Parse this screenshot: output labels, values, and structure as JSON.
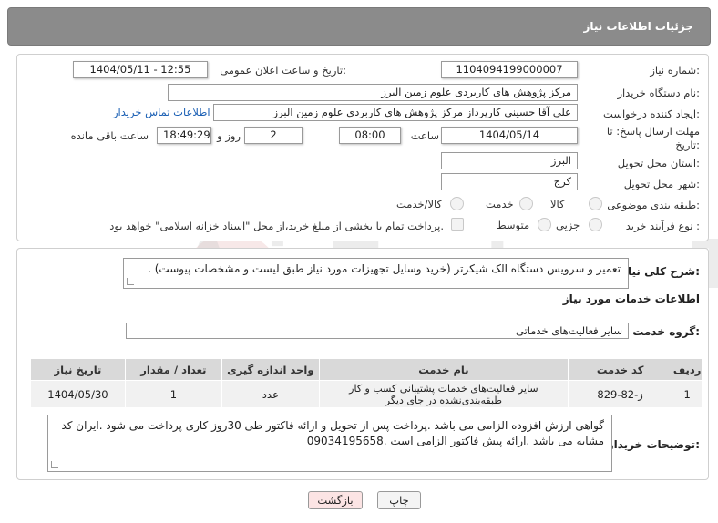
{
  "header": {
    "title": "جزئیات اطلاعات نیاز"
  },
  "form": {
    "need_number_label": "شماره نیاز:",
    "need_number": "1104094199000007",
    "announce_label": "تاریخ و ساعت اعلان عمومی:",
    "announce_value": "1404/05/11 - 12:55",
    "buyer_org_label": "نام دستگاه خریدار:",
    "buyer_org": "مرکز پژوهش های کاربردی علوم زمین البرز",
    "requester_label": "ایجاد کننده درخواست:",
    "requester": "علی آقا حسینی کارپرداز مرکز پژوهش های کاربردی علوم زمین البرز",
    "contact_link": "اطلاعات تماس خریدار",
    "deadline_label_line1": "مهلت ارسال پاسخ: تا",
    "deadline_label_line2": "تاریخ:",
    "deadline_date": "1404/05/14",
    "time_label": "ساعت",
    "deadline_time": "08:00",
    "days_value": "2",
    "days_label": "روز و",
    "remaining_time": "18:49:29",
    "remaining_label": "ساعت باقی مانده",
    "province_label": "استان محل تحویل:",
    "province": "البرز",
    "city_label": "شهر محل تحویل:",
    "city": "کرج",
    "category_label": "طبقه بندی موضوعی:",
    "category_options": [
      "کالا",
      "خدمت",
      "کالا/خدمت"
    ],
    "process_label": "نوع فرآیند خرید :",
    "process_options": [
      "جزیی",
      "متوسط"
    ],
    "payment_note": "پرداخت تمام یا بخشی از مبلغ خرید،از محل \"اسناد خزانه اسلامی\" خواهد بود."
  },
  "details": {
    "summary_label": "شرح کلی نیاز:",
    "summary": "تعمیر و سرویس دستگاه الک شیکرتر (خرید وسایل تجهیزات مورد نیاز طبق لیست و مشخصات پیوست) .",
    "services_heading": "اطلاعات خدمات مورد نیاز",
    "service_group_label": "گروه خدمت:",
    "service_group": "سایر فعالیت‌های خدماتی",
    "table": {
      "headers": [
        "ردیف",
        "کد خدمت",
        "نام خدمت",
        "واحد اندازه گیری",
        "تعداد / مقدار",
        "تاریخ نیاز"
      ],
      "rows": [
        [
          "1",
          "ز-82-829",
          "سایر فعالیت‌های خدمات پشتیبانی کسب و کار طبقه‌بندی‌نشده در جای دیگر",
          "عدد",
          "1",
          "1404/05/30"
        ]
      ]
    },
    "buyer_notes_label": "توضیحات خریدار:",
    "buyer_notes": "گواهی ارزش افزوده الزامی می باشد .پرداخت پس از تحویل  و ارائه فاکتور طی 30روز کاری پرداخت می شود .ایران کد مشابه می باشد .ارائه پیش فاکتور الزامی است .09034195658"
  },
  "buttons": {
    "print": "چاپ",
    "back": "بازگشت"
  },
  "colors": {
    "title_bar": "#8b8b8b",
    "link": "#1a5fb4",
    "back_button": "#fce4e4"
  }
}
